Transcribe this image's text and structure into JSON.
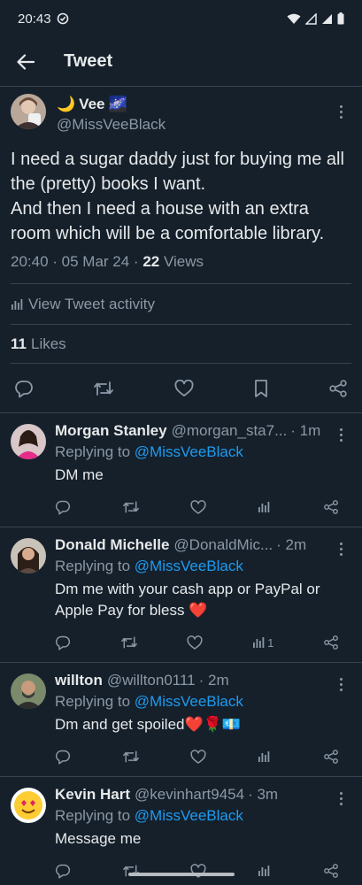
{
  "status_bar": {
    "time": "20:43"
  },
  "header": {
    "title": "Tweet"
  },
  "tweet": {
    "author_name": "Vee",
    "author_handle": "@MissVeeBlack",
    "text": "I need a sugar daddy just for buying me all the (pretty) books I want.\nAnd then I need a house with an extra room which will be a comfortable library.",
    "timestamp": "20:40 · 05 Mar 24 · ",
    "views_count": "22",
    "views_label": " Views",
    "activity_label": "View Tweet activity",
    "likes_count": "11",
    "likes_label": "Likes"
  },
  "replies": [
    {
      "name": "Morgan Stanley",
      "handle": "@morgan_sta7...",
      "time": "· 1m",
      "replying_prefix": "Replying to ",
      "replying_to": "@MissVeeBlack",
      "text": "DM me",
      "views": ""
    },
    {
      "name": "Donald Michelle",
      "handle": "@DonaldMic...",
      "time": "· 2m",
      "replying_prefix": "Replying to ",
      "replying_to": "@MissVeeBlack",
      "text": "Dm me with your cash app or PayPal or Apple Pay for bless ❤️",
      "views": "1"
    },
    {
      "name": "willton",
      "handle": "@willton0111",
      "time": "· 2m",
      "replying_prefix": "Replying to ",
      "replying_to": "@MissVeeBlack",
      "text": "Dm and get spoiled❤️🌹💶",
      "views": ""
    },
    {
      "name": "Kevin Hart",
      "handle": "@kevinhart9454",
      "time": "· 3m",
      "replying_prefix": "Replying to ",
      "replying_to": "@MissVeeBlack",
      "text": "Message me",
      "views": ""
    }
  ],
  "colors": {
    "background": "#15202b",
    "accent": "#1d9bf0",
    "muted": "#8b98a5",
    "divider": "#38444d"
  }
}
